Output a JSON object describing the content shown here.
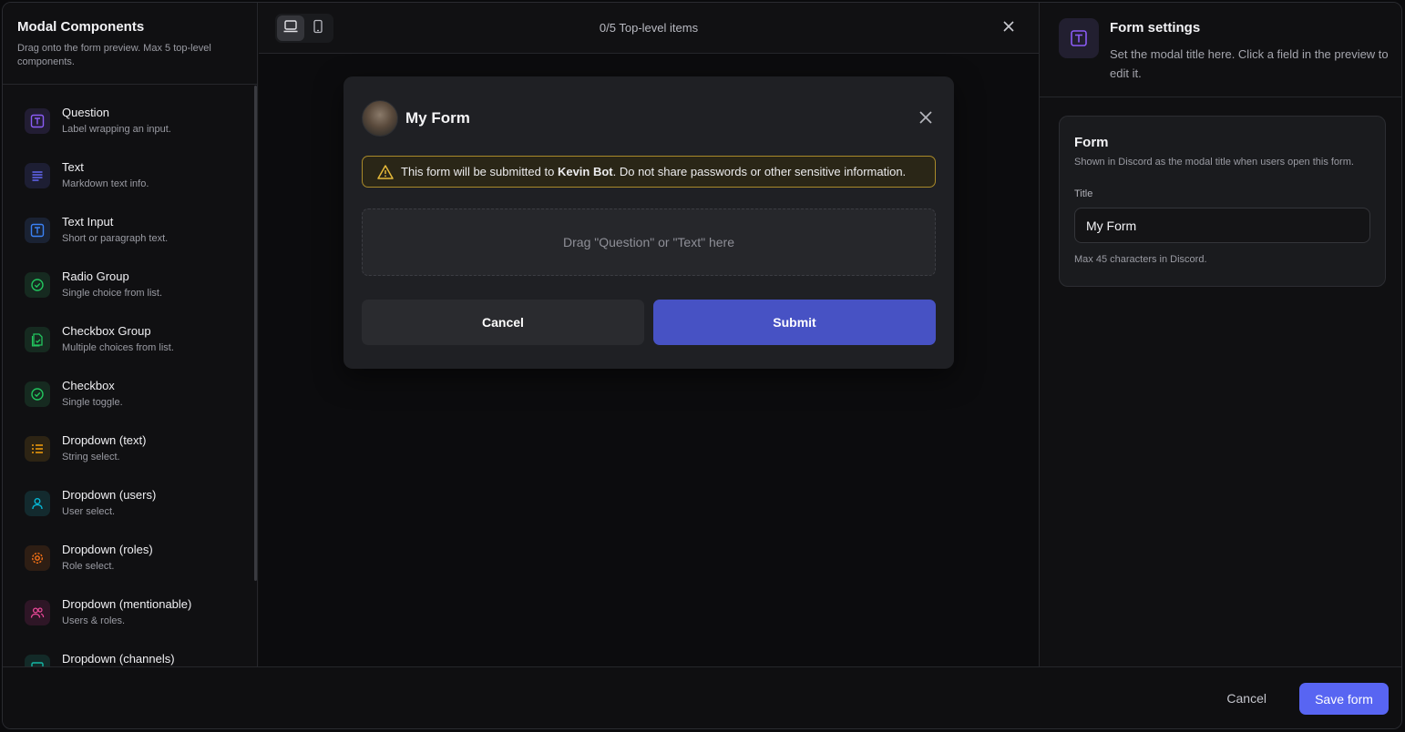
{
  "sidebar": {
    "title": "Modal Components",
    "subtitle": "Drag onto the form preview. Max 5 top-level components.",
    "items": [
      {
        "label": "Question",
        "desc": "Label wrapping an input.",
        "icon": "text-box-icon",
        "color": "#8b5cf6"
      },
      {
        "label": "Text",
        "desc": "Markdown text info.",
        "icon": "lines-icon",
        "color": "#6366f1"
      },
      {
        "label": "Text Input",
        "desc": "Short or paragraph text.",
        "icon": "text-box-icon",
        "color": "#3b82f6"
      },
      {
        "label": "Radio Group",
        "desc": "Single choice from list.",
        "icon": "check-circle-icon",
        "color": "#22c55e"
      },
      {
        "label": "Checkbox Group",
        "desc": "Multiple choices from list.",
        "icon": "document-check-icon",
        "color": "#22c55e"
      },
      {
        "label": "Checkbox",
        "desc": "Single toggle.",
        "icon": "check-circle-icon",
        "color": "#22c55e"
      },
      {
        "label": "Dropdown (text)",
        "desc": "String select.",
        "icon": "list-icon",
        "color": "#f59e0b"
      },
      {
        "label": "Dropdown (users)",
        "desc": "User select.",
        "icon": "user-icon",
        "color": "#06b6d4"
      },
      {
        "label": "Dropdown (roles)",
        "desc": "Role select.",
        "icon": "gear-icon",
        "color": "#f97316"
      },
      {
        "label": "Dropdown (mentionable)",
        "desc": "Users & roles.",
        "icon": "users-icon",
        "color": "#ec4899"
      },
      {
        "label": "Dropdown (channels)",
        "desc": "",
        "icon": "channel-icon",
        "color": "#14b8a6"
      }
    ]
  },
  "center": {
    "count_label": "0/5 Top-level items"
  },
  "modal": {
    "title": "My Form",
    "warning_prefix": "This form will be submitted to ",
    "warning_bot": "Kevin Bot",
    "warning_suffix": ". Do not share passwords or other sensitive information.",
    "dropzone": "Drag \"Question\" or \"Text\" here",
    "cancel_label": "Cancel",
    "submit_label": "Submit"
  },
  "right": {
    "title": "Form settings",
    "subtitle": "Set the modal title here. Click a field in the preview to edit it.",
    "card_title": "Form",
    "card_subtitle": "Shown in Discord as the modal title when users open this form.",
    "field_label": "Title",
    "field_value": "My Form",
    "field_hint": "Max 45 characters in Discord."
  },
  "footer": {
    "cancel_label": "Cancel",
    "save_label": "Save form"
  },
  "colors": {
    "accent": "#5865f2",
    "submit": "#4752c4",
    "warning_border": "#a98a2a"
  }
}
